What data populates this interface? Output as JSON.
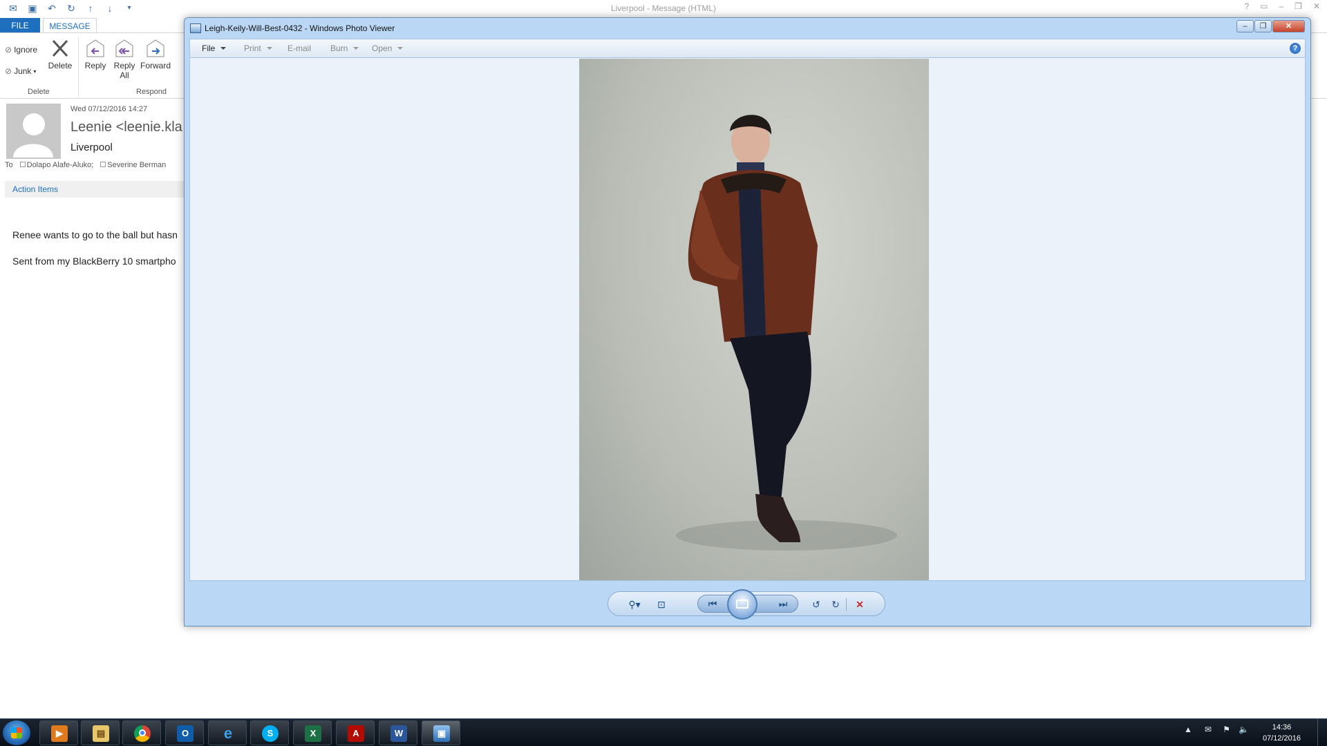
{
  "outlook": {
    "window_title": "Liverpool - Message (HTML)",
    "tabs": {
      "file": "FILE",
      "message": "MESSAGE"
    },
    "ribbon": {
      "ignore": "Ignore",
      "junk": "Junk",
      "delete": "Delete",
      "reply": "Reply",
      "reply_all_line1": "Reply",
      "reply_all_line2": "All",
      "forward": "Forward",
      "group_delete": "Delete",
      "group_respond": "Respond"
    },
    "message": {
      "date": "Wed 07/12/2016 14:27",
      "from": "Leenie <leenie.kla",
      "subject": "Liverpool",
      "to_label": "To",
      "recipients": [
        "Dolapo Alafe-Aluko;",
        "Severine Berman"
      ],
      "action_items": "Action Items",
      "body_line1": "Renee wants to go to the ball but hasn",
      "body_line2": "Sent from my BlackBerry 10 smartpho"
    }
  },
  "photo_viewer": {
    "title": "Leigh-Keily-Will-Best-0432 - Windows Photo Viewer",
    "menu": [
      "File",
      "Print",
      "E-mail",
      "Burn",
      "Open"
    ],
    "help": "?"
  },
  "taskbar": {
    "apps": [
      "media-player",
      "file-explorer",
      "chrome",
      "outlook",
      "internet-explorer",
      "skype",
      "excel",
      "acrobat",
      "word",
      "photo-viewer"
    ],
    "time": "14:36",
    "date": "07/12/2016"
  },
  "colors": {
    "outlook_accent": "#1e6fbd",
    "viewer_frame": "#bad7f5",
    "viewer_canvas": "#ebf2fa",
    "taskbar": "#0e1620"
  }
}
